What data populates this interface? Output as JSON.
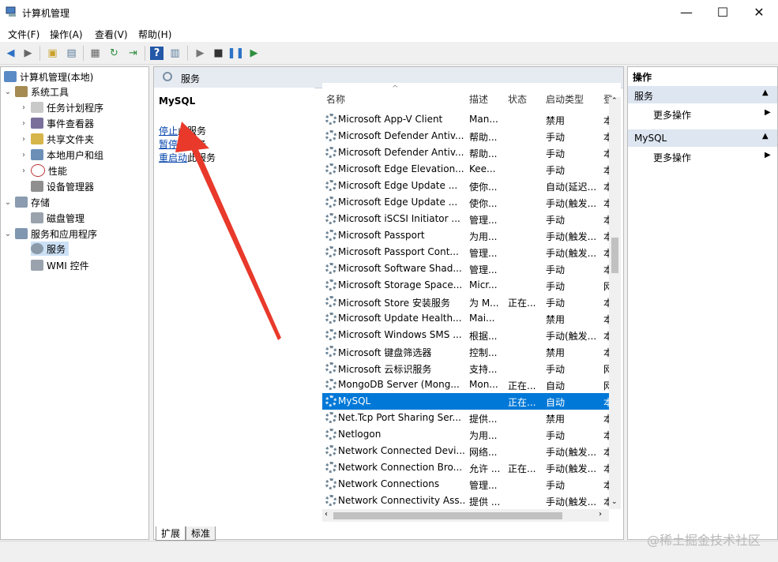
{
  "window": {
    "title": "计算机管理",
    "minimize": "—",
    "maximize": "☐",
    "close": "✕"
  },
  "menu": [
    "文件(F)",
    "操作(A)",
    "查看(V)",
    "帮助(H)"
  ],
  "tree": {
    "root": "计算机管理(本地)",
    "system_tools": "系统工具",
    "task_scheduler": "任务计划程序",
    "event_viewer": "事件查看器",
    "shared_folders": "共享文件夹",
    "local_users": "本地用户和组",
    "performance": "性能",
    "device_manager": "设备管理器",
    "storage": "存储",
    "disk_management": "磁盘管理",
    "services_apps": "服务和应用程序",
    "services": "服务",
    "wmi": "WMI 控件"
  },
  "services_pane": {
    "header": "服务",
    "selected_name": "MySQL",
    "stop_link": "停止",
    "stop_suffix": "此服务",
    "pause_link": "暂停",
    "pause_suffix": "此服务",
    "restart_link": "重启动",
    "restart_suffix": "此服务"
  },
  "columns": {
    "name": "名称",
    "desc": "描述",
    "status": "状态",
    "startup": "启动类型",
    "logon": "登"
  },
  "rows": [
    {
      "name": "Microsoft App-V Client",
      "desc": "Man...",
      "status": "",
      "startup": "禁用",
      "logon": "本"
    },
    {
      "name": "Microsoft Defender Antiv...",
      "desc": "帮助...",
      "status": "",
      "startup": "手动",
      "logon": "本"
    },
    {
      "name": "Microsoft Defender Antiv...",
      "desc": "帮助...",
      "status": "",
      "startup": "手动",
      "logon": "本"
    },
    {
      "name": "Microsoft Edge Elevation...",
      "desc": "Kee...",
      "status": "",
      "startup": "手动",
      "logon": "本"
    },
    {
      "name": "Microsoft Edge Update ...",
      "desc": "使你...",
      "status": "",
      "startup": "自动(延迟...",
      "logon": "本"
    },
    {
      "name": "Microsoft Edge Update ...",
      "desc": "使你...",
      "status": "",
      "startup": "手动(触发...",
      "logon": "本"
    },
    {
      "name": "Microsoft iSCSI Initiator ...",
      "desc": "管理...",
      "status": "",
      "startup": "手动",
      "logon": "本"
    },
    {
      "name": "Microsoft Passport",
      "desc": "为用...",
      "status": "",
      "startup": "手动(触发...",
      "logon": "本"
    },
    {
      "name": "Microsoft Passport Cont...",
      "desc": "管理...",
      "status": "",
      "startup": "手动(触发...",
      "logon": "本"
    },
    {
      "name": "Microsoft Software Shad...",
      "desc": "管理...",
      "status": "",
      "startup": "手动",
      "logon": "本"
    },
    {
      "name": "Microsoft Storage Space...",
      "desc": "Micr...",
      "status": "",
      "startup": "手动",
      "logon": "网"
    },
    {
      "name": "Microsoft Store 安装服务",
      "desc": "为 M...",
      "status": "正在...",
      "startup": "手动",
      "logon": "本"
    },
    {
      "name": "Microsoft Update Health...",
      "desc": "Mai...",
      "status": "",
      "startup": "禁用",
      "logon": "本"
    },
    {
      "name": "Microsoft Windows SMS ...",
      "desc": "根据...",
      "status": "",
      "startup": "手动(触发...",
      "logon": "本"
    },
    {
      "name": "Microsoft 键盘筛选器",
      "desc": "控制...",
      "status": "",
      "startup": "禁用",
      "logon": "本"
    },
    {
      "name": "Microsoft 云标识服务",
      "desc": "支持...",
      "status": "",
      "startup": "手动",
      "logon": "网"
    },
    {
      "name": "MongoDB Server (Mong...",
      "desc": "Mon...",
      "status": "正在...",
      "startup": "自动",
      "logon": "网"
    },
    {
      "name": "MySQL",
      "desc": "",
      "status": "正在...",
      "startup": "自动",
      "logon": "本"
    },
    {
      "name": "Net.Tcp Port Sharing Ser...",
      "desc": "提供...",
      "status": "",
      "startup": "禁用",
      "logon": "本"
    },
    {
      "name": "Netlogon",
      "desc": "为用...",
      "status": "",
      "startup": "手动",
      "logon": "本"
    },
    {
      "name": "Network Connected Devi...",
      "desc": "网络...",
      "status": "",
      "startup": "手动(触发...",
      "logon": "本"
    },
    {
      "name": "Network Connection Bro...",
      "desc": "允许 ...",
      "status": "正在...",
      "startup": "手动(触发...",
      "logon": "本"
    },
    {
      "name": "Network Connections",
      "desc": "管理...",
      "status": "",
      "startup": "手动",
      "logon": "本"
    },
    {
      "name": "Network Connectivity Ass...",
      "desc": "提供 ...",
      "status": "",
      "startup": "手动(触发...",
      "logon": "本"
    }
  ],
  "tabs": {
    "extended": "扩展",
    "standard": "标准"
  },
  "actions": {
    "title": "操作",
    "section1": "服务",
    "more1": "更多操作",
    "section2": "MySQL",
    "more2": "更多操作"
  },
  "watermark": "@稀土掘金技术社区",
  "colors": {
    "selection": "#0078d7",
    "annotation_arrow": "#e8392b",
    "link": "#0645ad"
  }
}
